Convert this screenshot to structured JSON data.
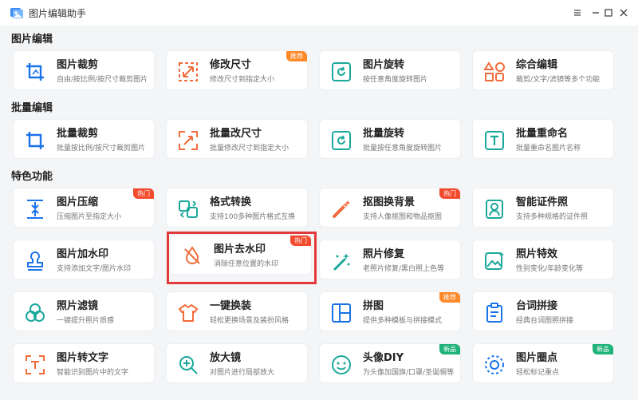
{
  "window": {
    "title": "图片编辑助手"
  },
  "sections": [
    {
      "title": "图片编辑",
      "cards": [
        {
          "title": "图片裁剪",
          "desc": "自由/按比例/按尺寸裁剪图片",
          "icon": "crop-icon",
          "badge": ""
        },
        {
          "title": "修改尺寸",
          "desc": "修改尺寸到指定大小",
          "icon": "resize-icon",
          "badge": "推荐"
        },
        {
          "title": "图片旋转",
          "desc": "按任意角度旋转图片",
          "icon": "rotate-icon",
          "badge": ""
        },
        {
          "title": "综合编辑",
          "desc": "裁剪/文字/滤镜等多个功能",
          "icon": "shapes-icon",
          "badge": ""
        }
      ]
    },
    {
      "title": "批量编辑",
      "cards": [
        {
          "title": "批量裁剪",
          "desc": "批量按比例/按尺寸裁剪图片",
          "icon": "crop-icon",
          "badge": ""
        },
        {
          "title": "批量改尺寸",
          "desc": "批量修改尺寸到指定大小",
          "icon": "resize-icon",
          "badge": ""
        },
        {
          "title": "批量旋转",
          "desc": "批量按任意角度旋转图片",
          "icon": "rotate-icon",
          "badge": ""
        },
        {
          "title": "批量重命名",
          "desc": "批量重命名图片名称",
          "icon": "text-icon",
          "badge": ""
        }
      ]
    },
    {
      "title": "特色功能",
      "cards": [
        {
          "title": "图片压缩",
          "desc": "压缩图片至指定大小",
          "icon": "compress-icon",
          "badge": "热门"
        },
        {
          "title": "格式转换",
          "desc": "支持100多种图片格式互换",
          "icon": "convert-icon",
          "badge": ""
        },
        {
          "title": "抠图换背景",
          "desc": "支持人像抠图和物品抠图",
          "icon": "wand-icon",
          "badge": "热门"
        },
        {
          "title": "智能证件照",
          "desc": "支持多种规格的证件照",
          "icon": "id-photo-icon",
          "badge": ""
        },
        {
          "title": "图片加水印",
          "desc": "支持添加文字/图片水印",
          "icon": "stamp-icon",
          "badge": ""
        },
        {
          "title": "图片去水印",
          "desc": "消除任意位置的水印",
          "icon": "no-drop-icon",
          "badge": "热门"
        },
        {
          "title": "照片修复",
          "desc": "老照片修复/黑白照上色等",
          "icon": "magic-icon",
          "badge": ""
        },
        {
          "title": "照片特效",
          "desc": "性别变化/年龄变化等",
          "icon": "image-effect-icon",
          "badge": ""
        },
        {
          "title": "照片滤镜",
          "desc": "一键提升照片质感",
          "icon": "filter-icon",
          "badge": ""
        },
        {
          "title": "一键换装",
          "desc": "轻松更换场景及装扮风格",
          "icon": "shirt-icon",
          "badge": ""
        },
        {
          "title": "拼图",
          "desc": "提供多种模板与拼接模式",
          "icon": "collage-icon",
          "badge": "推荐"
        },
        {
          "title": "台词拼接",
          "desc": "经典台词图照拼接",
          "icon": "clipboard-icon",
          "badge": ""
        },
        {
          "title": "图片转文字",
          "desc": "智能识别图片中的文字",
          "icon": "ocr-icon",
          "badge": ""
        },
        {
          "title": "放大镜",
          "desc": "对图片进行局部放大",
          "icon": "zoom-icon",
          "badge": ""
        },
        {
          "title": "头像DIY",
          "desc": "为头像加国旗/口罩/圣诞帽等",
          "icon": "smile-icon",
          "badge": "新品"
        },
        {
          "title": "图片圈点",
          "desc": "轻松标记重点",
          "icon": "circle-mark-icon",
          "badge": "新品"
        }
      ]
    }
  ],
  "colors": {
    "accent": "#1a73e8",
    "orange": "#f26b3a",
    "teal": "#1aa89a",
    "highlight": "#e23a3a"
  }
}
